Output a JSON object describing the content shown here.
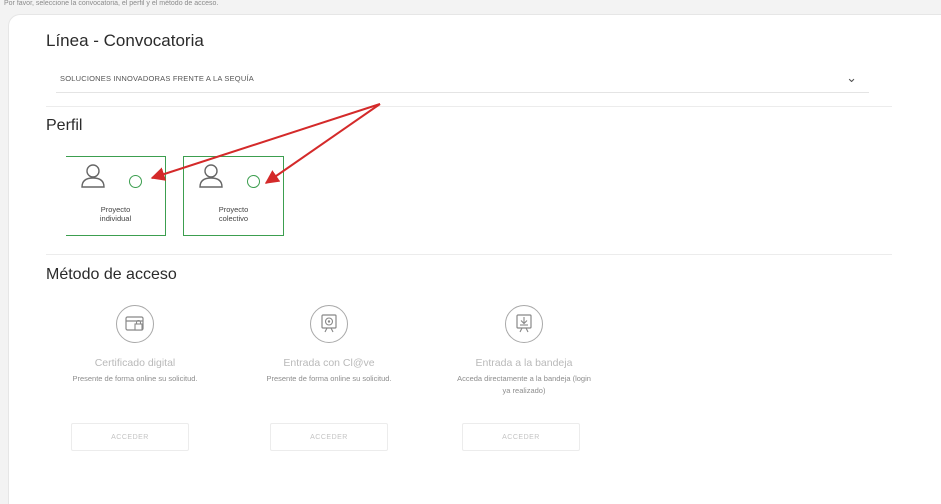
{
  "top_note": "Por favor, seleccione la convocatoria, el perfil y el método de acceso.",
  "linea": {
    "heading": "Línea - Convocatoria",
    "selected_value": "SOLUCIONES INNOVADORAS FRENTE A LA SEQUÍA"
  },
  "perfil": {
    "heading": "Perfil",
    "options": [
      {
        "label_line1": "Proyecto",
        "label_line2": "individual"
      },
      {
        "label_line1": "Proyecto",
        "label_line2": "colectivo"
      }
    ]
  },
  "metodo": {
    "heading": "Método de acceso",
    "options": [
      {
        "icon": "certificate-icon",
        "title": "Certificado digital",
        "description": "Presente de forma online su solicitud.",
        "button": "ACCEDER"
      },
      {
        "icon": "clave-icon",
        "title": "Entrada con Cl@ve",
        "description": "Presente de forma online su solicitud.",
        "button": "ACCEDER"
      },
      {
        "icon": "tray-icon",
        "title": "Entrada a la bandeja",
        "description": "Acceda directamente a la bandeja (login ya realizado)",
        "button": "ACCEDER"
      }
    ]
  },
  "colors": {
    "accent_green": "#3c9e4f",
    "annotation_red": "#d42a2a"
  }
}
